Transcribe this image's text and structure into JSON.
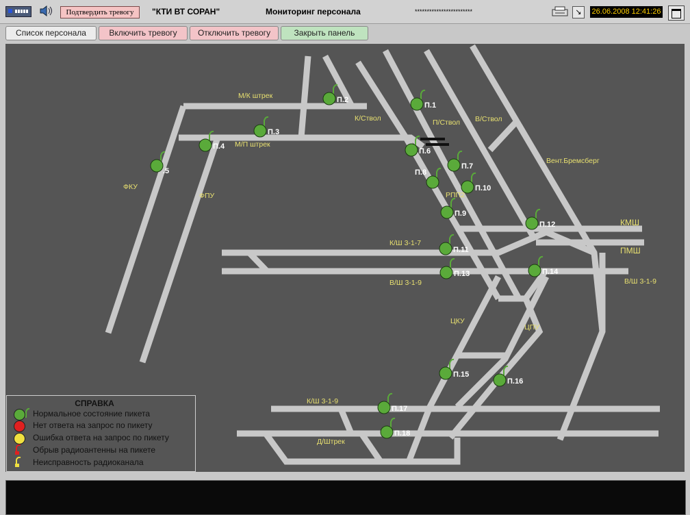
{
  "window": {
    "confirm_alarm": "Подтвердить тревогу",
    "org": "\"КТИ ВТ СОРАН\"",
    "title": "Мониторинг персонала",
    "stars": "************************",
    "clock": "26.06.2008 12:41:26"
  },
  "toolbar": {
    "staff_list": "Список персонала",
    "alarm_on": "Включить тревогу",
    "alarm_off": "Отключить тревогу",
    "close_panel": "Закрыть панель"
  },
  "map_labels": [
    {
      "id": "mk",
      "text": "М/К штрек"
    },
    {
      "id": "mp",
      "text": "М/П штрек"
    },
    {
      "id": "kstvol",
      "text": "К/Ствол"
    },
    {
      "id": "pstvol",
      "text": "П/Ствол"
    },
    {
      "id": "vstvol",
      "text": "В/Ствол"
    },
    {
      "id": "vent",
      "text": "Вент.Бремсберг"
    },
    {
      "id": "fku",
      "text": "ФКУ"
    },
    {
      "id": "fpu",
      "text": "ФПУ"
    },
    {
      "id": "rpp2",
      "text": "РПП2"
    },
    {
      "id": "kmsh",
      "text": "КМШ"
    },
    {
      "id": "pmsh",
      "text": "ПМШ"
    },
    {
      "id": "ksh317",
      "text": "К/Ш 3-1-7"
    },
    {
      "id": "vsh319a",
      "text": "В/Ш 3-1-9"
    },
    {
      "id": "vsh319b",
      "text": "В/Ш 3-1-9"
    },
    {
      "id": "cku",
      "text": "ЦКУ"
    },
    {
      "id": "cpu",
      "text": "ЦПУ"
    },
    {
      "id": "ksh319",
      "text": "К/Ш 3-1-9"
    },
    {
      "id": "dshtrek",
      "text": "Д/Штрек"
    }
  ],
  "pickets": [
    {
      "id": "p1",
      "label": "П.1",
      "status": "normal"
    },
    {
      "id": "p2",
      "label": "П.2",
      "status": "normal"
    },
    {
      "id": "p3",
      "label": "П.3",
      "status": "normal"
    },
    {
      "id": "p4",
      "label": "П.4",
      "status": "normal"
    },
    {
      "id": "p5",
      "label": ".5",
      "status": "normal"
    },
    {
      "id": "p6",
      "label": "П.6",
      "status": "normal"
    },
    {
      "id": "p7",
      "label": "П.7",
      "status": "normal"
    },
    {
      "id": "p8",
      "label": "П.8",
      "status": "normal"
    },
    {
      "id": "p9",
      "label": "П.9",
      "status": "normal"
    },
    {
      "id": "p10",
      "label": "П.10",
      "status": "normal"
    },
    {
      "id": "p11",
      "label": "П.11",
      "status": "normal"
    },
    {
      "id": "p12",
      "label": "П.12",
      "status": "normal"
    },
    {
      "id": "p13",
      "label": "П.13",
      "status": "normal"
    },
    {
      "id": "p14",
      "label": "П.14",
      "status": "normal"
    },
    {
      "id": "p15",
      "label": "П.15",
      "status": "normal"
    },
    {
      "id": "p16",
      "label": "П.16",
      "status": "normal"
    },
    {
      "id": "p17",
      "label": "П.17",
      "status": "normal"
    },
    {
      "id": "p18",
      "label": "П.18",
      "status": "normal"
    }
  ],
  "legend": {
    "title": "СПРАВКА",
    "items": [
      {
        "text": "Нормальное состояние пикета",
        "color": "#5aaa3a"
      },
      {
        "text": "Нет ответа на запрос по пикету",
        "color": "#e02020"
      },
      {
        "text": "Ошибка ответа на запрос по пикету",
        "color": "#f0e040"
      },
      {
        "text": "Обрыв радиоантенны на пикете",
        "color": "#e02020"
      },
      {
        "text": "Неисправность радиоканала",
        "color": "#f0e040"
      }
    ]
  },
  "colors": {
    "tunnel": "#c8c8c8",
    "label": "#e8e070",
    "picket": "#5aaa3a",
    "panel": "#555555"
  }
}
